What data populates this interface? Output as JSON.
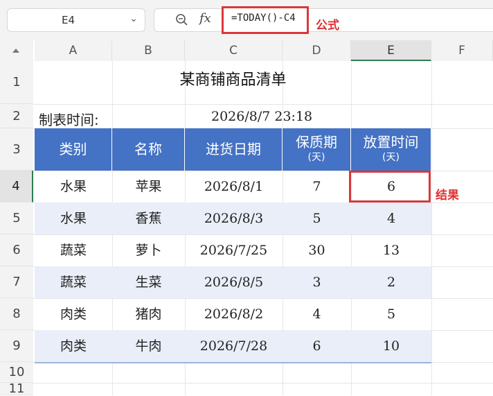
{
  "formula_bar": {
    "cell_ref": "E4",
    "fx_label": "fx",
    "formula": "=TODAY()-C4",
    "annotation": "公式"
  },
  "columns": [
    "A",
    "B",
    "C",
    "D",
    "E",
    "F"
  ],
  "rows": [
    "1",
    "2",
    "3",
    "4",
    "5",
    "6",
    "7",
    "8",
    "9",
    "10",
    "11"
  ],
  "sheet": {
    "title": "某商铺商品清单",
    "date_label": "制表时间:",
    "date_value": "2026/8/7  23:18",
    "headers": [
      {
        "main": "类别",
        "sub": ""
      },
      {
        "main": "名称",
        "sub": ""
      },
      {
        "main": "进货日期",
        "sub": ""
      },
      {
        "main": "保质期",
        "sub": "(天)"
      },
      {
        "main": "放置时间",
        "sub": "(天)"
      }
    ],
    "data": [
      [
        "水果",
        "苹果",
        "2026/8/1",
        "7",
        "6"
      ],
      [
        "水果",
        "香蕉",
        "2026/8/3",
        "5",
        "4"
      ],
      [
        "蔬菜",
        "萝卜",
        "2026/7/25",
        "30",
        "13"
      ],
      [
        "蔬菜",
        "生菜",
        "2026/8/5",
        "3",
        "2"
      ],
      [
        "肉类",
        "猪肉",
        "2026/8/2",
        "4",
        "5"
      ],
      [
        "肉类",
        "牛肉",
        "2026/7/28",
        "6",
        "10"
      ]
    ]
  },
  "result_annotation": "结果",
  "colors": {
    "header_bg": "#4472c4",
    "band_bg": "#e9eef8",
    "annotation": "#e03030",
    "select_green": "#2e7d4f"
  }
}
